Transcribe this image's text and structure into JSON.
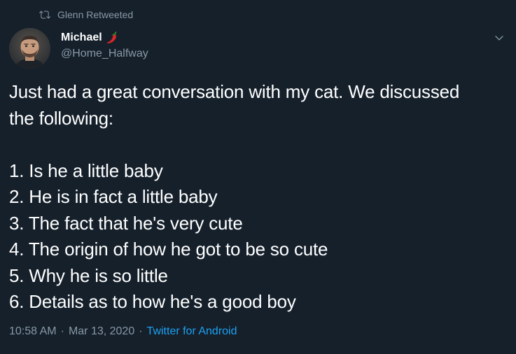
{
  "retweet": {
    "label": "Glenn Retweeted",
    "icon": "retweet-icon"
  },
  "author": {
    "display_name": "Michael",
    "emoji_icon": "hot-pepper-icon",
    "handle": "@Home_Halfway",
    "avatar_icon": "user-avatar"
  },
  "tweet": {
    "text": "Just had a great conversation with my cat. We discussed\nthe following:\n\n1. Is he a little baby\n2. He is in fact a little baby\n3. The fact that he's very cute\n4. The origin of how he got to be so cute\n5. Why he is so little\n6. Details as to how he's a good boy"
  },
  "meta": {
    "time": "10:58 AM",
    "separator1": "·",
    "date": "Mar 13, 2020",
    "separator2": "·",
    "source": "Twitter for Android"
  },
  "colors": {
    "background": "#15202b",
    "secondary_text": "#8899a6",
    "link": "#1da1f2",
    "primary_text": "#ffffff"
  }
}
